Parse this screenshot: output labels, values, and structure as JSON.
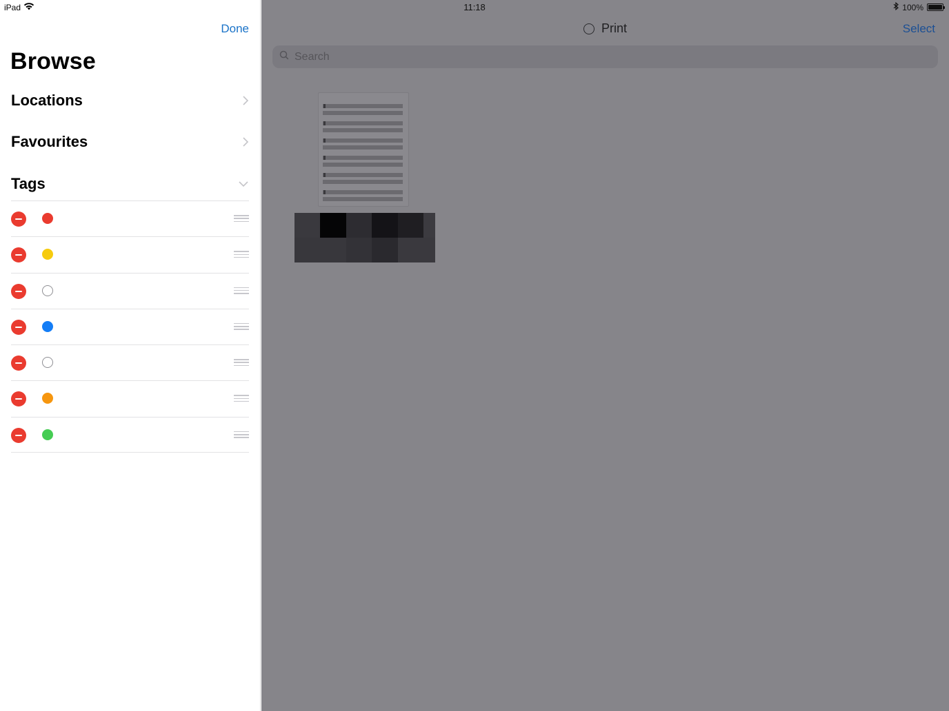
{
  "status_bar": {
    "device": "iPad",
    "time": "11:18",
    "battery": "100%",
    "battery_level": 1.0,
    "icons": [
      "wifi-icon",
      "bluetooth-icon",
      "battery-icon"
    ]
  },
  "sidebar": {
    "done_label": "Done",
    "title": "Browse",
    "sections": [
      {
        "label": "Locations",
        "state": "collapsed"
      },
      {
        "label": "Favourites",
        "state": "collapsed"
      },
      {
        "label": "Tags",
        "state": "expanded"
      }
    ],
    "tags": [
      {
        "color": "#ea3b2f",
        "style": "filled"
      },
      {
        "color": "#f6cb0e",
        "style": "filled"
      },
      {
        "color": "#8e8e93",
        "style": "hollow"
      },
      {
        "color": "#147df6",
        "style": "filled"
      },
      {
        "color": "#8e8e93",
        "style": "hollow"
      },
      {
        "color": "#f6960f",
        "style": "filled"
      },
      {
        "color": "#45cc53",
        "style": "filled"
      }
    ]
  },
  "main": {
    "folder_title": "Print",
    "select_label": "Select",
    "search_placeholder": "Search",
    "accent_color": "#1a73c8",
    "files": [
      {
        "name_redacted": true,
        "type": "document-thumbnail"
      }
    ]
  }
}
